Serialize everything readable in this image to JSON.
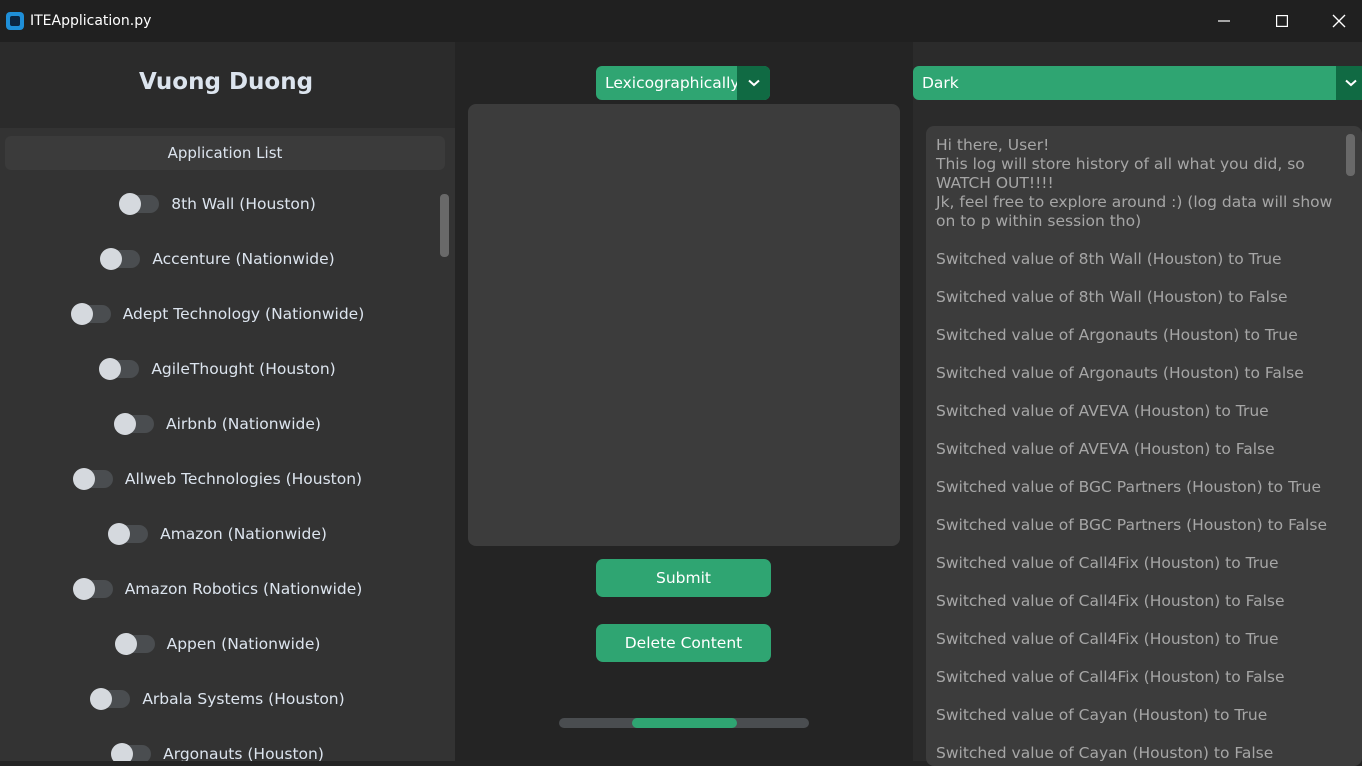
{
  "window": {
    "title": "ITEApplication.py",
    "controls": [
      "minimize-icon",
      "maximize-icon",
      "close-icon"
    ]
  },
  "profile": {
    "name": "Vuong Duong"
  },
  "application_list": {
    "header": "Application List",
    "items": [
      {
        "label": "8th Wall (Houston)",
        "enabled": false
      },
      {
        "label": "Accenture (Nationwide)",
        "enabled": false
      },
      {
        "label": "Adept Technology (Nationwide)",
        "enabled": false
      },
      {
        "label": "AgileThought (Houston)",
        "enabled": false
      },
      {
        "label": "Airbnb (Nationwide)",
        "enabled": false
      },
      {
        "label": "Allweb Technologies (Houston)",
        "enabled": false
      },
      {
        "label": "Amazon (Nationwide)",
        "enabled": false
      },
      {
        "label": "Amazon Robotics (Nationwide)",
        "enabled": false
      },
      {
        "label": "Appen (Nationwide)",
        "enabled": false
      },
      {
        "label": "Arbala Systems (Houston)",
        "enabled": false
      },
      {
        "label": "Argonauts (Houston)",
        "enabled": false
      }
    ]
  },
  "sort": {
    "selected": "Lexicographically"
  },
  "editor": {
    "content": ""
  },
  "buttons": {
    "submit": "Submit",
    "delete": "Delete Content"
  },
  "progress": {
    "start_fraction": 0.29,
    "end_fraction": 0.71
  },
  "theme": {
    "selected": "Dark"
  },
  "log": {
    "intro": [
      "Hi there, User!",
      "This log will store history of all what you did, so WATCH OUT!!!!",
      "Jk, feel free to explore around :) (log data will show on to p within session tho)"
    ],
    "entries": [
      "Switched value of 8th Wall (Houston) to True",
      "Switched value of 8th Wall (Houston) to False",
      "Switched value of Argonauts (Houston) to True",
      "Switched value of Argonauts (Houston) to False",
      "Switched value of AVEVA (Houston) to True",
      "Switched value of AVEVA (Houston) to False",
      "Switched value of BGC Partners (Houston) to True",
      "Switched value of BGC Partners (Houston) to False",
      "Switched value of Call4Fix (Houston) to True",
      "Switched value of Call4Fix (Houston) to False",
      "Switched value of Call4Fix (Houston) to True",
      "Switched value of Call4Fix (Houston) to False",
      "Switched value of Cayan (Houston) to True",
      "Switched value of Cayan (Houston) to False"
    ]
  },
  "colors": {
    "accent": "#2fa572",
    "accent_dark": "#106a43",
    "panel": "#2b2b2b",
    "background": "#242424"
  }
}
